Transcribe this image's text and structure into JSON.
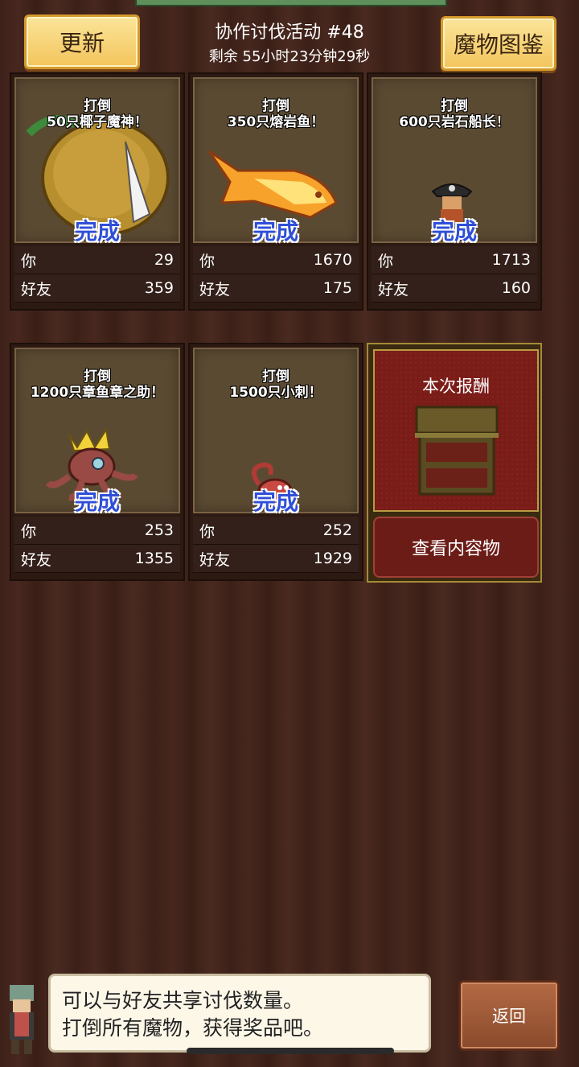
{
  "header": {
    "refresh_label": "更新",
    "title": "协作讨伐活动 #48",
    "countdown": "剩余 55小时23分钟29秒",
    "bestiary_label": "魔物图鉴"
  },
  "labels": {
    "you": "你",
    "friends": "好友",
    "complete": "完成"
  },
  "quests": [
    {
      "goal_line1": "打倒",
      "goal_line2": "50只椰子魔神！",
      "you": "29",
      "friends": "359",
      "monster": "coconut-monster"
    },
    {
      "goal_line1": "打倒",
      "goal_line2": "350只熔岩鱼！",
      "you": "1670",
      "friends": "175",
      "monster": "lava-fish"
    },
    {
      "goal_line1": "打倒",
      "goal_line2": "600只岩石船长！",
      "you": "1713",
      "friends": "160",
      "monster": "rock-captain"
    },
    {
      "goal_line1": "打倒",
      "goal_line2": "1200只章鱼章之助！",
      "you": "253",
      "friends": "1355",
      "monster": "octopus-king"
    },
    {
      "goal_line1": "打倒",
      "goal_line2": "1500只小刺！",
      "you": "252",
      "friends": "1929",
      "monster": "small-scorpion"
    }
  ],
  "reward": {
    "title": "本次报酬",
    "view_label": "查看内容物",
    "icon": "treasure-chest"
  },
  "footer": {
    "message_line1": "可以与好友共享讨伐数量。",
    "message_line2": "打倒所有魔物，获得奖品吧。",
    "back_label": "返回"
  },
  "colors": {
    "gold_button": "#f3c45c",
    "complete_text": "#2f4fd8",
    "reward_bg": "#7a1c18"
  }
}
